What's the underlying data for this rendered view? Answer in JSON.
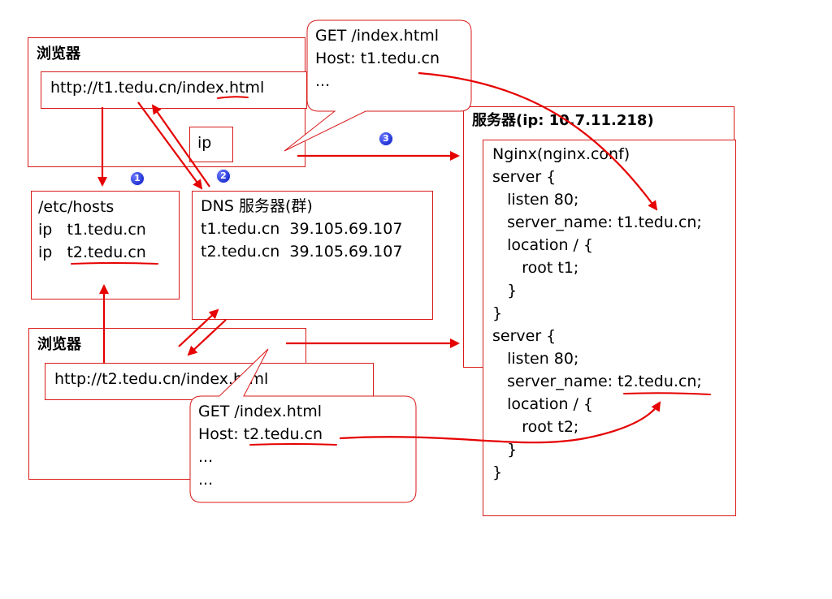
{
  "browser1": {
    "title": "浏览器",
    "url": "http://t1.tedu.cn/index.html",
    "ip_label": "ip"
  },
  "hosts": {
    "lines": [
      "/etc/hosts",
      "ip   t1.tedu.cn",
      "ip   t2.tedu.cn"
    ]
  },
  "dns": {
    "lines": [
      "DNS 服务器(群)",
      "t1.tedu.cn  39.105.69.107",
      "t2.tedu.cn  39.105.69.107"
    ]
  },
  "request1": {
    "lines": [
      "GET /index.html",
      "Host: t1.tedu.cn",
      "..."
    ]
  },
  "server": {
    "title": "服务器(ip: 10.7.11.218)",
    "config_lines": [
      "Nginx(nginx.conf)",
      "server {",
      "   listen 80;",
      "   server_name: t1.tedu.cn;",
      "   location / {",
      "      root t1;",
      "   }",
      "}",
      "server {",
      "   listen 80;",
      "   server_name: t2.tedu.cn;",
      "   location / {",
      "      root t2;",
      "   }",
      "}"
    ]
  },
  "browser2": {
    "title": "浏览器",
    "url": "http://t2.tedu.cn/index.html"
  },
  "request2": {
    "lines": [
      "GET /index.html",
      "Host: t2.tedu.cn",
      "...",
      "..."
    ]
  },
  "badges": [
    "1",
    "2",
    "3"
  ],
  "colors": {
    "accent": "#e60000",
    "badge": "#1a2ad0"
  }
}
